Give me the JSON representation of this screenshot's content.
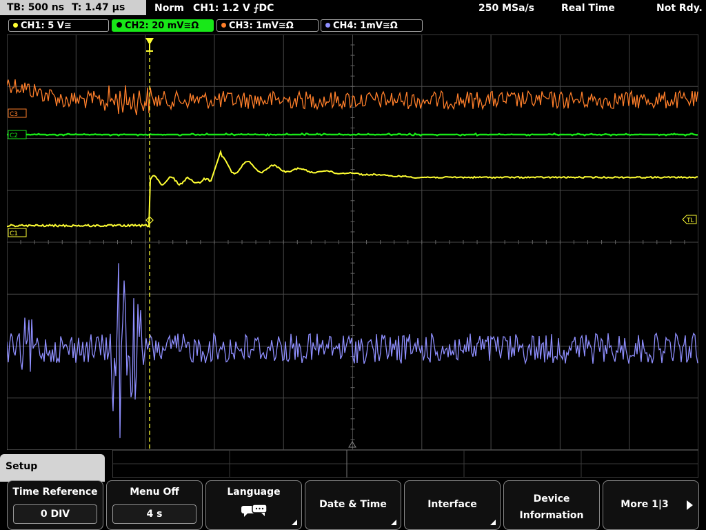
{
  "status": {
    "tb_label": "TB: 500 ns",
    "t_label": "T: 1.47 µs",
    "mode": "Norm",
    "trigger": "CH1: 1.2 V ⨍DC",
    "sample_rate": "250 MSa/s",
    "acq": "Real Time",
    "state": "Not Rdy."
  },
  "channels": [
    {
      "label": "CH1: 5 V≅",
      "color": "#ffff33"
    },
    {
      "label": "CH2: 20 mV≅Ω",
      "color": "#18e818"
    },
    {
      "label": "CH3: 1mV≅Ω",
      "color": "#ff7f2a"
    },
    {
      "label": "CH4: 1mV≅Ω",
      "color": "#8f8fff"
    }
  ],
  "markers": {
    "c3": "C3",
    "c2": "C2",
    "c1": "C1",
    "tl": "TL"
  },
  "menu": {
    "title": "Setup",
    "time_reference": {
      "label": "Time Reference",
      "value": "0 DIV"
    },
    "menu_off": {
      "label": "Menu Off",
      "value": "4 s"
    },
    "language": {
      "label": "Language"
    },
    "date_time": {
      "label": "Date & Time"
    },
    "interface": {
      "label": "Interface"
    },
    "device_info": {
      "line1": "Device",
      "line2": "Information"
    },
    "more": {
      "label": "More 1|3"
    }
  }
}
